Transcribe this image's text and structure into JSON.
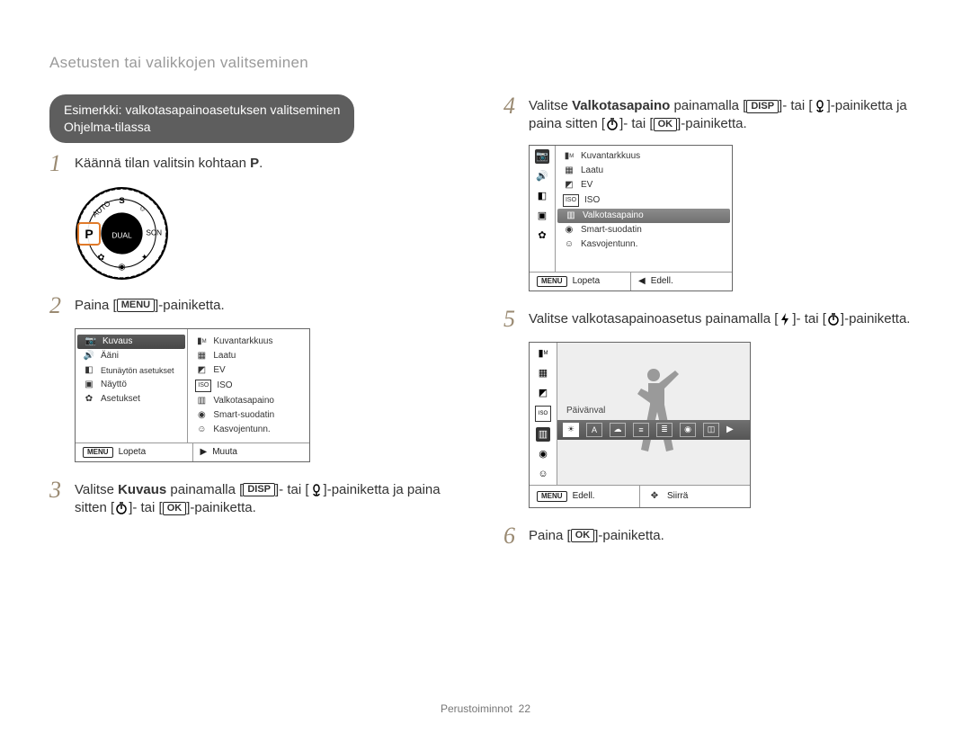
{
  "header": "Asetusten tai valikkojen valitseminen",
  "callout": {
    "line1": "Esimerkki: valkotasapainoasetuksen valitseminen",
    "line2": "Ohjelma-tilassa"
  },
  "steps": {
    "s1": {
      "num": "1",
      "pre": "Käännä tilan valitsin kohtaan ",
      "mode": "P",
      "post": "."
    },
    "s2": {
      "num": "2",
      "pre": "Paina [",
      "key": "MENU",
      "post": "]-painiketta."
    },
    "s3": {
      "num": "3",
      "pre": "Valitse ",
      "bold1": "Kuvaus",
      "mid1": " painamalla [",
      "key1": "DISP",
      "mid2": "]- tai [",
      "mid3": "]-painiketta ja paina sitten [",
      "mid4": "]- tai [",
      "key2": "OK",
      "post": "]-painiketta."
    },
    "s4": {
      "num": "4",
      "pre": "Valitse ",
      "bold1": "Valkotasapaino",
      "mid1": " painamalla [",
      "key1": "DISP",
      "mid2": "]- tai [",
      "mid3": "]-painiketta ja paina sitten [",
      "mid4": "]- tai [",
      "key2": "OK",
      "post": "]-painiketta."
    },
    "s5": {
      "num": "5",
      "pre": "Valitse valkotasapainoasetus painamalla [",
      "mid1": "]- tai [",
      "post": "]-painiketta."
    },
    "s6": {
      "num": "6",
      "pre": "Paina [",
      "key": "OK",
      "post": "]-painiketta."
    }
  },
  "panelA": {
    "left": [
      "Kuvaus",
      "Ääni",
      "Etunäytön asetukset",
      "Näyttö",
      "Asetukset"
    ],
    "right": [
      "Kuvantarkkuus",
      "Laatu",
      "EV",
      "ISO",
      "Valkotasapaino",
      "Smart-suodatin",
      "Kasvojentunn."
    ],
    "footerLeftKey": "MENU",
    "footerLeft": "Lopeta",
    "footerRightGlyph": "▶",
    "footerRight": "Muuta"
  },
  "panelB": {
    "list": [
      "Kuvantarkkuus",
      "Laatu",
      "EV",
      "ISO",
      "Valkotasapaino",
      "Smart-suodatin",
      "Kasvojentunn."
    ],
    "selected": "Valkotasapaino",
    "footerLeftKey": "MENU",
    "footerLeft": "Lopeta",
    "footerRightGlyph": "◀",
    "footerRight": "Edell."
  },
  "panelC": {
    "label": "Päivänval",
    "footerLeftKey": "MENU",
    "footerLeft": "Edell.",
    "footerRight": "Siirrä"
  },
  "footer": {
    "section": "Perustoiminnot",
    "page": "22"
  }
}
